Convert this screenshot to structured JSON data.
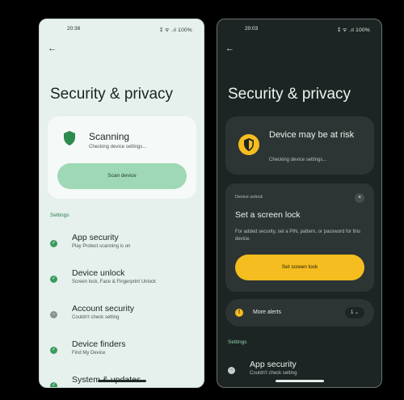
{
  "light": {
    "status": {
      "time": "20:38",
      "indicators": "⁑ ᯤ .ıl 100%"
    },
    "title": "Security & privacy",
    "scan": {
      "title": "Scanning",
      "subtitle": "Checking device settings...",
      "button": "Scan device",
      "shield_color": "#2e8b4e"
    },
    "settings_label": "Settings",
    "items": [
      {
        "name": "App security",
        "desc": "Play Protect scanning is on",
        "status": "ok"
      },
      {
        "name": "Device unlock",
        "desc": "Screen lock, Face & Fingerprint Unlock",
        "status": "ok"
      },
      {
        "name": "Account security",
        "desc": "Couldn't check setting",
        "status": "neutral"
      },
      {
        "name": "Device finders",
        "desc": "Find My Device",
        "status": "ok"
      },
      {
        "name": "System & updates",
        "desc": "",
        "status": "ok"
      }
    ]
  },
  "dark": {
    "status": {
      "time": "20:03",
      "indicators": "⁑ ᯤ .ıl 100%"
    },
    "title": "Security & privacy",
    "risk": {
      "title": "Device may be at risk",
      "subtitle": "Checking device settings..."
    },
    "lock_card": {
      "small_label": "Device unlock",
      "title": "Set a screen lock",
      "description": "For added security, set a PIN, pattern, or password for this device.",
      "button": "Set screen lock",
      "close_icon": "×"
    },
    "alerts": {
      "label": "More alerts",
      "count": "1 ⌄",
      "icon": "!"
    },
    "settings_label": "Settings",
    "items": [
      {
        "name": "App security",
        "desc": "Couldn't check setting",
        "status": "neutral"
      }
    ]
  },
  "colors": {
    "accent_green": "#3a9a5e",
    "accent_yellow": "#f5bd1f",
    "scan_button": "#9fd8b5"
  }
}
